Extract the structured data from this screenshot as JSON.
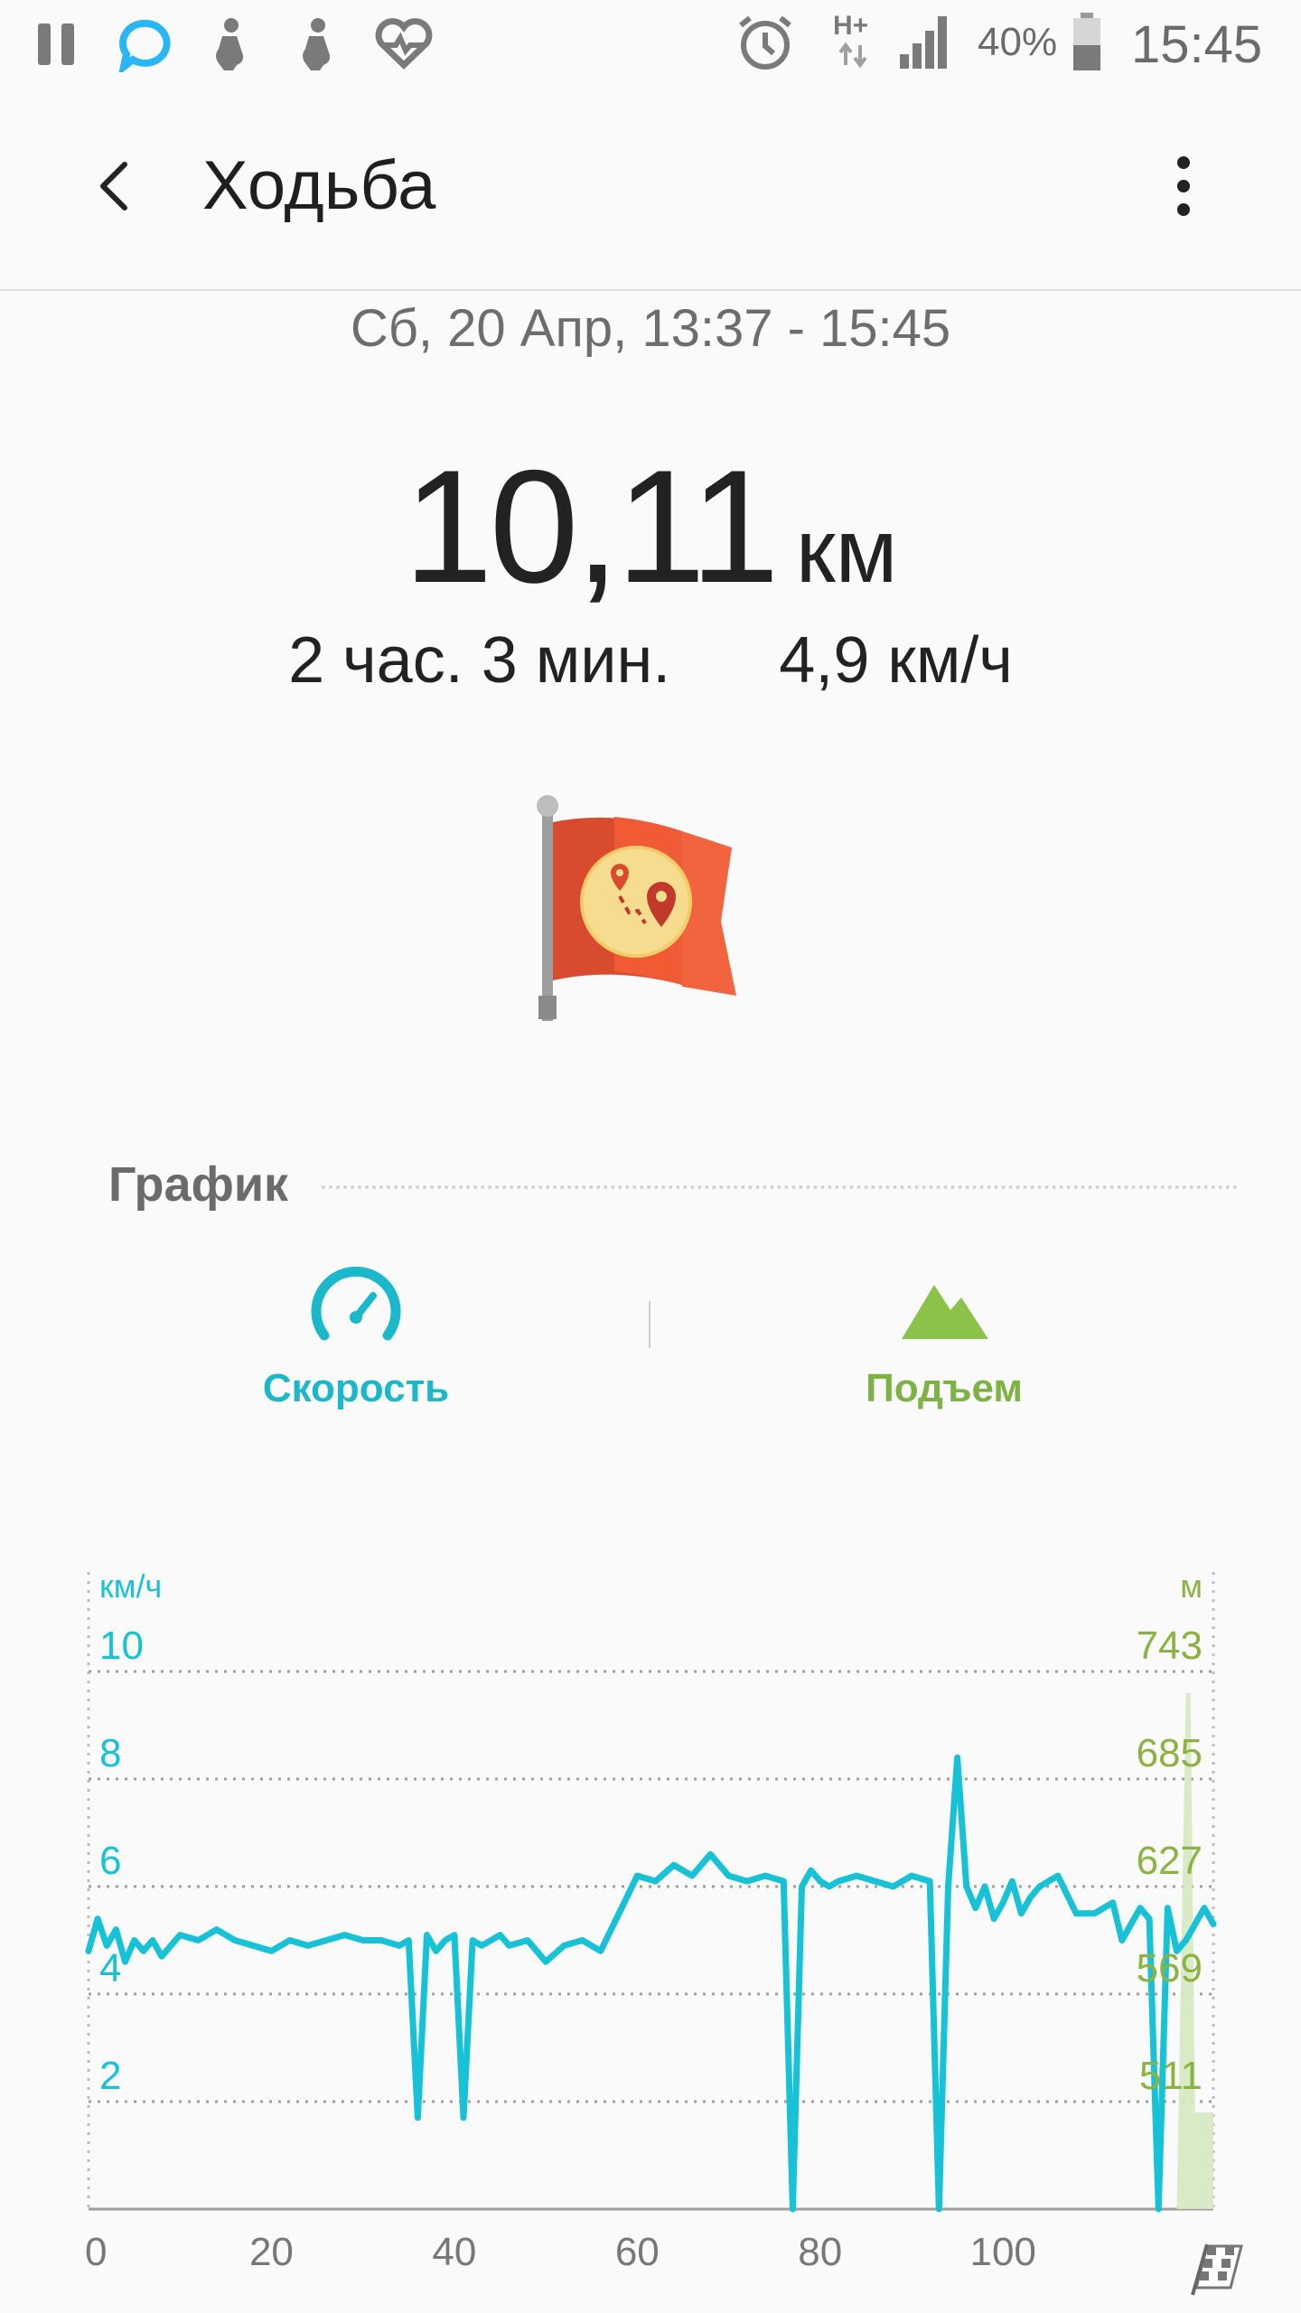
{
  "status_bar": {
    "battery_percent": "40%",
    "time": "15:45",
    "network": "H+",
    "icons": [
      "pause-icon",
      "chat-bubble-icon",
      "pregnancy-icon",
      "pregnancy-icon",
      "heart-rate-icon",
      "alarm-icon",
      "network-hplus-icon",
      "signal-icon",
      "battery-icon"
    ]
  },
  "app_bar": {
    "title": "Ходьба",
    "back_icon": "back-arrow-icon",
    "menu_icon": "more-vert-icon"
  },
  "workout": {
    "datetime": "Сб, 20 Апр, 13:37 - 15:45",
    "distance": "10,11",
    "distance_unit": "км",
    "duration": "2 час. 3 мин.",
    "avg_speed": "4,9 км/ч",
    "badge_icon": "route-flag-icon"
  },
  "graph": {
    "title": "График",
    "tabs": [
      {
        "label": "Скорость",
        "icon": "speedometer-icon",
        "color": "#1bb8cc"
      },
      {
        "label": "Подъем",
        "icon": "mountain-icon",
        "color": "#7cb342"
      }
    ]
  },
  "colors": {
    "speed": "#17c2d6",
    "elevation": "#8bb342",
    "elevation_fill": "#d5e8c0"
  },
  "chart_data": {
    "type": "line",
    "x_ticks": [
      "0",
      "20",
      "40",
      "60",
      "80",
      "100"
    ],
    "x_range": [
      0,
      123
    ],
    "left_unit": "км/ч",
    "right_unit": "м",
    "left_ticks": [
      "2",
      "4",
      "6",
      "8",
      "10"
    ],
    "right_ticks": [
      "511",
      "569",
      "627",
      "685",
      "743"
    ],
    "y_range": [
      0,
      10
    ],
    "grid": true,
    "series": [
      {
        "axis": "left",
        "x": [
          0,
          1,
          2,
          3,
          4,
          5,
          6,
          7,
          8,
          9,
          10,
          12,
          14,
          16,
          18,
          20,
          22,
          24,
          26,
          28,
          30,
          32,
          34,
          35,
          36,
          37,
          38,
          39,
          40,
          41,
          42,
          43,
          44,
          45,
          46,
          48,
          50,
          52,
          54,
          56,
          58,
          60,
          62,
          64,
          66,
          68,
          70,
          72,
          74,
          76,
          77,
          78,
          79,
          80,
          81,
          82,
          84,
          86,
          88,
          90,
          92,
          93,
          94,
          95,
          96,
          97,
          98,
          99,
          100,
          101,
          102,
          103,
          104,
          106,
          108,
          110,
          112,
          113,
          114,
          115,
          116,
          117,
          118,
          119,
          120,
          121,
          122,
          123
        ],
        "values": [
          4.8,
          5.4,
          4.9,
          5.2,
          4.6,
          5.0,
          4.8,
          5.0,
          4.7,
          4.9,
          5.1,
          5.0,
          5.2,
          5.0,
          4.9,
          4.8,
          5.0,
          4.9,
          5.0,
          5.1,
          5.0,
          5.0,
          4.9,
          5.0,
          1.7,
          5.1,
          4.8,
          5.0,
          5.1,
          1.7,
          5.0,
          4.9,
          5.0,
          5.1,
          4.9,
          5.0,
          4.6,
          4.9,
          5.0,
          4.8,
          5.5,
          6.2,
          6.1,
          6.4,
          6.2,
          6.6,
          6.2,
          6.1,
          6.2,
          6.1,
          0.0,
          6.0,
          6.3,
          6.1,
          6.0,
          6.1,
          6.2,
          6.1,
          6.0,
          6.2,
          6.1,
          0.0,
          6.0,
          8.4,
          6.0,
          5.6,
          6.0,
          5.4,
          5.7,
          6.1,
          5.5,
          5.8,
          6.0,
          6.2,
          5.5,
          5.5,
          5.7,
          5.0,
          5.3,
          5.6,
          5.4,
          0.0,
          5.6,
          4.8,
          5.0,
          5.3,
          5.6,
          5.3
        ]
      },
      {
        "axis": "right",
        "x": [
          119,
          120,
          120.5,
          121,
          121.5,
          122,
          123
        ],
        "values": [
          0.0,
          9.6,
          9.6,
          1.8,
          1.8,
          1.8,
          1.8
        ]
      }
    ]
  }
}
